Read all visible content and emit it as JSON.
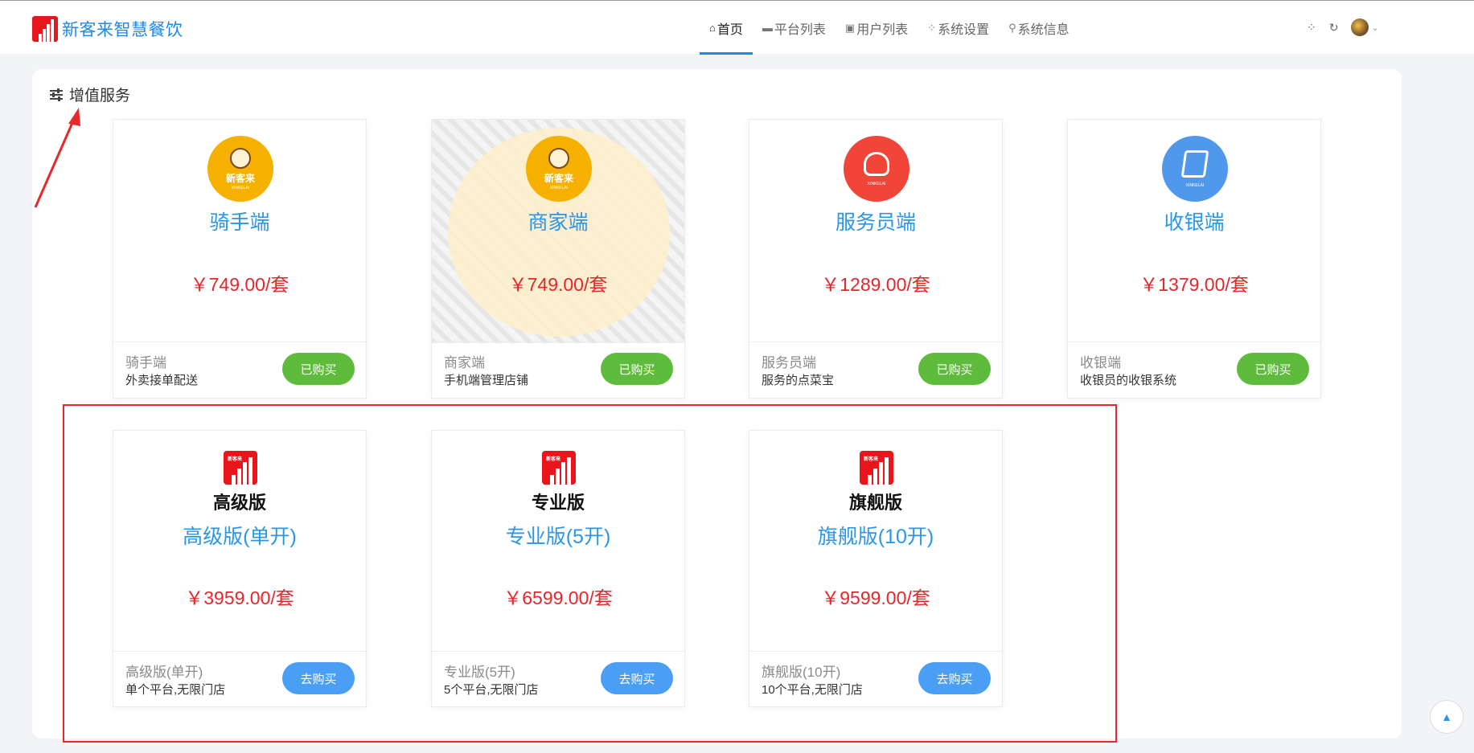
{
  "header": {
    "brand_name": "新客来智慧餐饮",
    "nav": [
      {
        "icon": "home-icon",
        "glyph": "⌂",
        "label": "首页"
      },
      {
        "icon": "store-icon",
        "glyph": "▬",
        "label": "平台列表"
      },
      {
        "icon": "image-icon",
        "glyph": "▣",
        "label": "用户列表"
      },
      {
        "icon": "apps-icon",
        "glyph": "⁘",
        "label": "系统设置"
      },
      {
        "icon": "search-icon",
        "glyph": "⚲",
        "label": "系统信息"
      }
    ],
    "tools": {
      "grid_glyph": "⁘",
      "refresh_glyph": "↻",
      "caret_glyph": "⌄"
    }
  },
  "section": {
    "title": "增值服务"
  },
  "cards_row1": [
    {
      "icon": "rider-icon",
      "icon_color": "#f6b100",
      "icon_text": "新客来",
      "icon_sub": "XINKELAI",
      "title": "骑手端",
      "price": "￥749.00/套",
      "name": "骑手端",
      "desc": "外卖接单配送",
      "button": "已购买"
    },
    {
      "icon": "merchant-icon",
      "icon_color": "#f6b100",
      "icon_text": "新客来",
      "icon_sub": "XINKELAI",
      "title": "商家端",
      "price": "￥749.00/套",
      "name": "商家端",
      "desc": "手机端管理店铺",
      "button": "已购买"
    },
    {
      "icon": "waiter-icon",
      "icon_color": "#f04538",
      "icon_text": "",
      "icon_sub": "XINKELAI",
      "title": "服务员端",
      "price": "￥1289.00/套",
      "name": "服务员端",
      "desc": "服务的点菜宝",
      "button": "已购买"
    },
    {
      "icon": "cashier-icon",
      "icon_color": "#4f98ec",
      "icon_text": "",
      "icon_sub": "XINKELAI",
      "title": "收银端",
      "price": "￥1379.00/套",
      "name": "收银端",
      "desc": "收银员的收银系统",
      "button": "已购买"
    }
  ],
  "cards_row2": [
    {
      "logo_name": "高级版",
      "title": "高级版(单开)",
      "price": "￥3959.00/套",
      "name": "高级版(单开)",
      "desc": "单个平台,无限门店",
      "button": "去购买"
    },
    {
      "logo_name": "专业版",
      "title": "专业版(5开)",
      "price": "￥6599.00/套",
      "name": "专业版(5开)",
      "desc": "5个平台,无限门店",
      "button": "去购买"
    },
    {
      "logo_name": "旗舰版",
      "title": "旗舰版(10开)",
      "price": "￥9599.00/套",
      "name": "旗舰版(10开)",
      "desc": "10个平台,无限门店",
      "button": "去购买"
    }
  ],
  "logo_tag": "新客来",
  "back_top_glyph": "▲",
  "colors": {
    "brand": "#1e88e5",
    "price": "#e6262b",
    "bought": "#5fbb3b",
    "buy": "#4a9ff5",
    "annotation": "#e8282b"
  }
}
